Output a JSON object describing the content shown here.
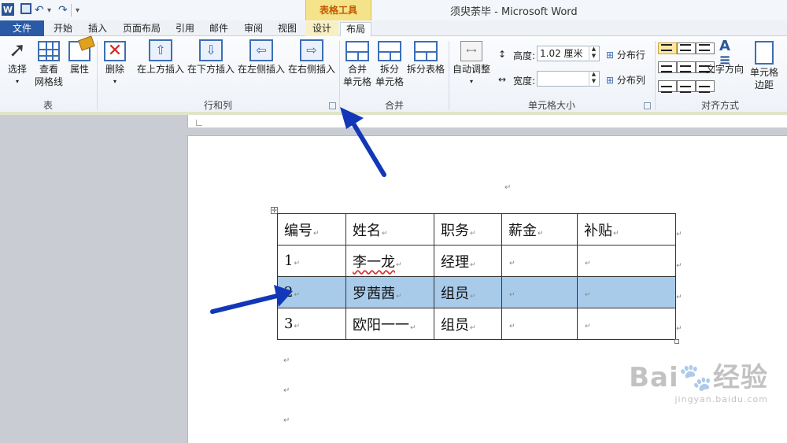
{
  "titlebar": {
    "app_icon": "W",
    "table_tools": "表格工具",
    "window_title": "须臾荼毕 - Microsoft Word",
    "quick_access": [
      "word-logo-icon",
      "save-icon",
      "undo-icon",
      "redo-icon",
      "customize-icon"
    ]
  },
  "tabs": [
    {
      "label": "文件"
    },
    {
      "label": "开始"
    },
    {
      "label": "插入"
    },
    {
      "label": "页面布局"
    },
    {
      "label": "引用"
    },
    {
      "label": "邮件"
    },
    {
      "label": "审阅"
    },
    {
      "label": "视图"
    },
    {
      "label": "设计"
    },
    {
      "label": "布局"
    }
  ],
  "ribbon": {
    "table_group": {
      "label": "表",
      "select": "选择",
      "gridlines_line1": "查看",
      "gridlines_line2": "网格线",
      "properties": "属性"
    },
    "rows_cols_group": {
      "label": "行和列",
      "delete": "删除",
      "insert_above": "在上方插入",
      "insert_below": "在下方插入",
      "insert_left": "在左侧插入",
      "insert_right": "在右侧插入"
    },
    "merge_group": {
      "label": "合并",
      "merge_line1": "合并",
      "merge_line2": "单元格",
      "split_line1": "拆分",
      "split_line2": "单元格",
      "split_table": "拆分表格"
    },
    "cell_size_group": {
      "label": "单元格大小",
      "autofit": "自动调整",
      "height_label": "高度:",
      "height_value": "1.02 厘米",
      "width_label": "宽度:",
      "width_value": "",
      "distribute_rows": "分布行",
      "distribute_cols": "分布列"
    },
    "alignment_group": {
      "label": "对齐方式",
      "text_direction": "文字方向",
      "cell_margins_line1": "单元格",
      "cell_margins_line2": "边距"
    }
  },
  "document": {
    "table": {
      "headers": [
        "编号",
        "姓名",
        "职务",
        "薪金",
        "补贴"
      ],
      "rows": [
        [
          "1",
          "李一龙",
          "经理",
          "",
          ""
        ],
        [
          "2",
          "罗茜茜",
          "组员",
          "",
          ""
        ],
        [
          "3",
          "欧阳一一",
          "组员",
          "",
          ""
        ]
      ],
      "selected_row_index": 1
    },
    "paragraph_mark": "↵"
  },
  "watermark": {
    "brand": "Bai🐾经验",
    "url": "jingyan.baidu.com"
  },
  "colors": {
    "file_tab": "#2a5aa6",
    "table_tools_header": "#f5e38a",
    "selected_row": "#a9cbea",
    "annotation_arrow": "#1238b8"
  }
}
